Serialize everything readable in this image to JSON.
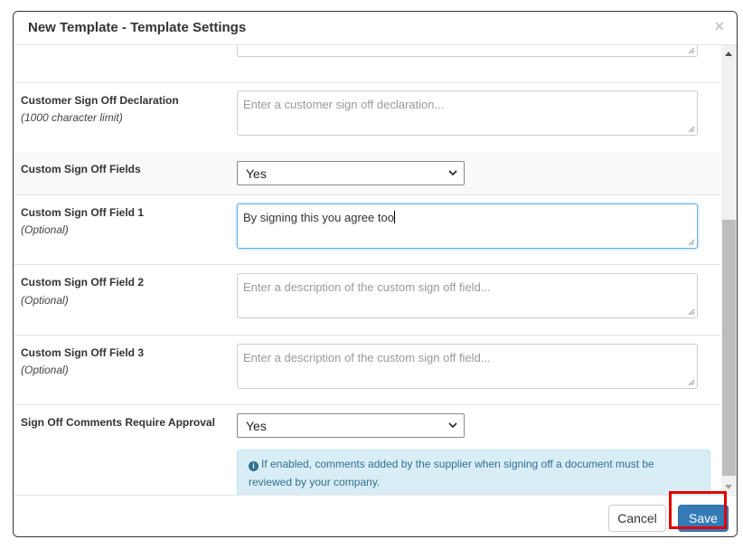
{
  "dialog": {
    "title": "New Template - Template Settings",
    "close_glyph": "×"
  },
  "fields": {
    "declaration": {
      "label": "Customer Sign Off Declaration",
      "sublabel": "(1000 character limit)",
      "placeholder": "Enter a customer sign off declaration..."
    },
    "custom_fields": {
      "label": "Custom Sign Off Fields",
      "value": "Yes"
    },
    "field1": {
      "label": "Custom Sign Off Field 1",
      "sublabel": "(Optional)",
      "value": "By signing this you agree too"
    },
    "field2": {
      "label": "Custom Sign Off Field 2",
      "sublabel": "(Optional)",
      "placeholder": "Enter a description of the custom sign off field..."
    },
    "field3": {
      "label": "Custom Sign Off Field 3",
      "sublabel": "(Optional)",
      "placeholder": "Enter a description of the custom sign off field..."
    },
    "approval": {
      "label": "Sign Off Comments Require Approval",
      "value": "Yes",
      "info_icon": "info-circle-icon",
      "info_line1": "If enabled, comments added by the supplier when signing off a document must be",
      "info_line2": "reviewed by your company."
    }
  },
  "footer": {
    "cancel_label": "Cancel",
    "save_label": "Save"
  },
  "colors": {
    "primary": "#337ab7",
    "info_bg": "#d9edf7",
    "info_text": "#31708f",
    "highlight": "#e00000"
  }
}
